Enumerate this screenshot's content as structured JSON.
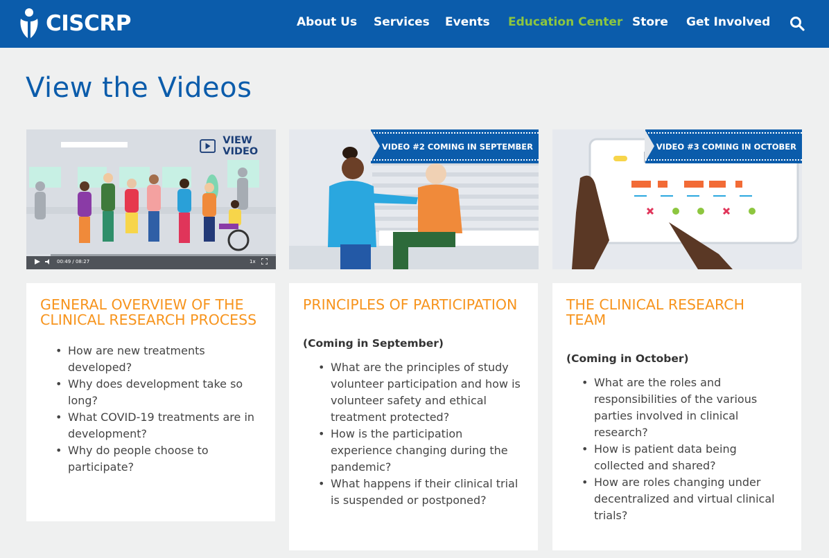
{
  "brand": {
    "name": "CISCRP",
    "primary": "#0b5cab",
    "accent": "#f7941d",
    "active": "#8dc63f"
  },
  "nav": {
    "items": [
      {
        "label": "About Us"
      },
      {
        "label": "Services"
      },
      {
        "label": "Events"
      },
      {
        "label": "Education Center",
        "active": true
      },
      {
        "label": "Store"
      },
      {
        "label": "Get Involved"
      }
    ],
    "search_icon": "search-icon"
  },
  "page": {
    "title": "View the Videos"
  },
  "videos": [
    {
      "overlay_label": "VIEW VIDEO",
      "player": {
        "time": "00:49 / 08:27",
        "speed": "1x",
        "progress": 0.097
      },
      "title": "GENERAL OVERVIEW OF THE CLINICAL RESEARCH PROCESS",
      "subtitle": "",
      "bullets": [
        "How are new treatments developed?",
        "Why does development take so long?",
        "What COVID-19 treatments are in development?",
        "Why do people choose to participate?"
      ]
    },
    {
      "banner": "VIDEO #2 COMING IN SEPTEMBER",
      "title": "PRINCIPLES OF PARTICIPATION",
      "subtitle": "(Coming in September)",
      "bullets": [
        "What are the principles of study volunteer participation and how is volunteer safety and ethical treatment protected?",
        "How is the participation experience changing during the pandemic?",
        "What happens if their clinical trial is suspended or postponed?"
      ]
    },
    {
      "banner": "VIDEO #3 COMING IN OCTOBER",
      "title": "THE CLINICAL RESEARCH TEAM",
      "subtitle": "(Coming in October)",
      "bullets": [
        "What are the roles and responsibilities of the various parties involved in clinical research?",
        "How is patient data being collected and shared?",
        "How are roles changing under decentralized and virtual clinical trials?"
      ]
    }
  ]
}
